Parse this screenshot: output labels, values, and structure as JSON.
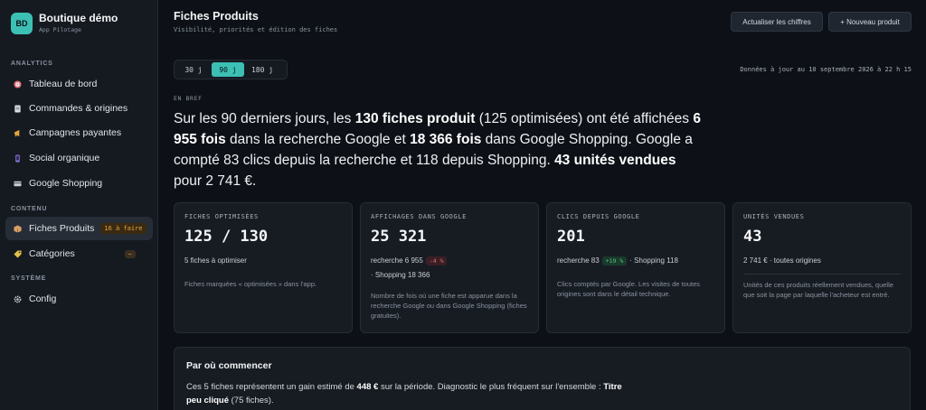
{
  "brand": {
    "initials": "BD",
    "name": "Boutique démo",
    "subtitle": "App Pilotage"
  },
  "sidebar": {
    "analytics_label": "ANALYTICS",
    "analytics_items": [
      {
        "label": "Tableau de bord",
        "icon": "target-icon"
      },
      {
        "label": "Commandes & origines",
        "icon": "document-icon"
      },
      {
        "label": "Campagnes payantes",
        "icon": "megaphone-icon"
      },
      {
        "label": "Social organique",
        "icon": "phone-icon"
      },
      {
        "label": "Google Shopping",
        "icon": "card-icon"
      }
    ],
    "content_label": "CONTENU",
    "content_items": [
      {
        "label": "Fiches Produits",
        "icon": "box-icon",
        "badge": "16 à faire",
        "active": true
      },
      {
        "label": "Catégories",
        "icon": "tag-icon",
        "badge": "–"
      }
    ],
    "system_label": "SYSTÈME",
    "system_items": [
      {
        "label": "Config",
        "icon": "gear-icon"
      }
    ]
  },
  "header": {
    "title": "Fiches Produits",
    "subtitle": "Visibilité, priorités et édition des fiches",
    "refresh_button": "Actualiser les chiffres",
    "new_button": "+ Nouveau produit"
  },
  "period": {
    "options": [
      "30 j",
      "90 j",
      "180 j"
    ],
    "selected": "90 j"
  },
  "updated_text": "Données à jour au 10 septembre 2026 à 22 h 15",
  "summary": {
    "eyebrow": "EN BREF",
    "p1": "Sur les 90 derniers jours, les ",
    "b1": "130 fiches produit",
    "p2": " (125 optimisées) ont été affichées ",
    "b2": "6 955 fois",
    "p3": " dans la recherche Google et ",
    "b3": "18 366 fois",
    "p4": " dans Google Shopping. Google a compté 83 clics depuis la recherche et 118 depuis Shopping. ",
    "b4": "43 unités vendues",
    "p5": " pour 2 741 €."
  },
  "cards": [
    {
      "label": "FICHES OPTIMISÉES",
      "value": "125 / 130",
      "sub": "5 fiches à optimiser",
      "desc": "Fiches marquées « optimisées » dans l'app."
    },
    {
      "label": "AFFICHAGES DANS GOOGLE",
      "value": "25 321",
      "sub_a": "recherche 6 955",
      "pill": "-4 %",
      "sub_b": "· Shopping 18 366",
      "desc": "Nombre de fois où une fiche est apparue dans la recherche Google ou dans Google Shopping (fiches gratuites)."
    },
    {
      "label": "CLICS DEPUIS GOOGLE",
      "value": "201",
      "sub_a": "recherche 83",
      "pill": "+19 %",
      "sub_b": "· Shopping 118",
      "desc": "Clics comptés par Google. Les visites de toutes origines sont dans le détail technique."
    },
    {
      "label": "UNITÉS VENDUES",
      "value": "43",
      "sub": "2 741 € · toutes origines",
      "desc": "Unités de ces produits réellement vendues, quelle que soit la page par laquelle l'acheteur est entré."
    }
  ],
  "start": {
    "title": "Par où commencer",
    "t1": "Ces 5 fiches représentent un gain estimé de ",
    "b1": "448 €",
    "t2": " sur la période. Diagnostic le plus fréquent sur l'ensemble : ",
    "b2": "Titre peu cliqué",
    "t3": " (75 fiches)."
  },
  "colors": {
    "accent": "#3cc0b4",
    "background": "#0d1117",
    "negative": "#e06c75",
    "positive": "#52c17f",
    "warning": "#e5a53a"
  }
}
